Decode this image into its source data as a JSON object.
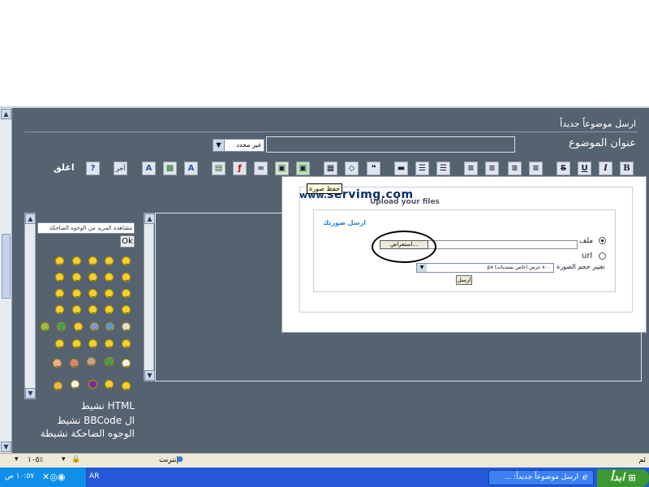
{
  "page": {
    "header_text": "ارسل موضوعاً جديداً",
    "subject_label": "عنوان الموضوع",
    "subject_value": "",
    "subject_select": "غير محدد",
    "close_label": "اغلق",
    "other_label": "أخر"
  },
  "toolbar": {
    "buttons": [
      "B",
      "I",
      "U",
      "S"
    ]
  },
  "smilies": {
    "more_label": "مشاهدة المزيد من الوجوه الضاحكة",
    "ok_label": "Ok"
  },
  "status_lines": {
    "html": "HTML نشيط",
    "bbcode": "ال BBCode نشيط",
    "smilies": "الوجوه الضاحكة نشيطة"
  },
  "upload": {
    "brand_prefix": "www.",
    "brand": "servimg.com",
    "tagline": "Upload your files",
    "tooltip": "حفظ صورة",
    "form_title": "ارسل صورتك",
    "file_label": "ملف",
    "browse_label": "استعراض...",
    "url_label": "url",
    "resize_label": "تغيير حجم الصورة",
    "resize_value": "px ٨٠٠ عرض (خاص بمنتديات)",
    "send_label": "ارسل"
  },
  "statusbar": {
    "zone": "إنترنت",
    "zoom": "١٠٥٪"
  },
  "taskbar": {
    "start_label": "ابدأ",
    "window_title": "ارسل موضوعاً جديداً: ...",
    "lang": "AR",
    "clock": "١٠:٥٧ ص"
  },
  "colors": {
    "panel": "#556270",
    "taskbar": "#2458d6",
    "start": "#3a9a2f"
  }
}
